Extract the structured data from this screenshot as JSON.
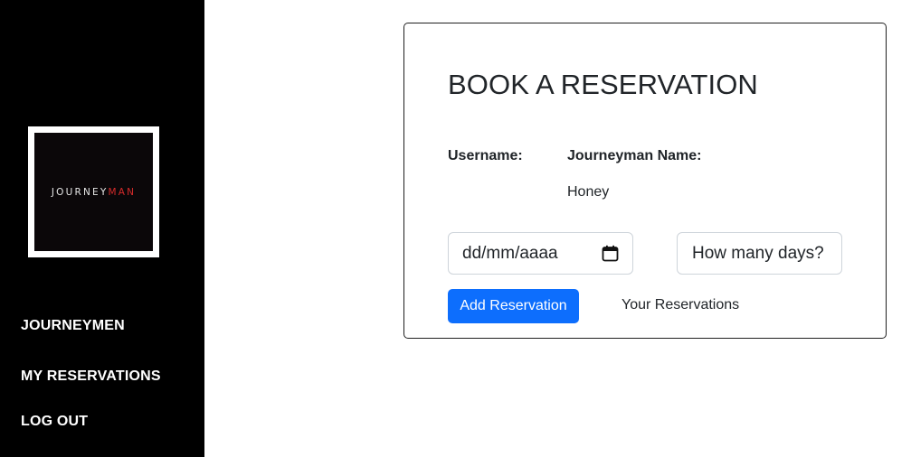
{
  "sidebar": {
    "logo": {
      "text_main": "JOURNEY",
      "text_accent": "MAN",
      "colors": {
        "background": "#0b0709",
        "text": "#e6e6e6",
        "accent": "#d42a2a"
      }
    },
    "nav": {
      "journeymen": "JOURNEYMEN",
      "my_reservations": "MY RESERVATIONS",
      "log_out": "LOG OUT"
    }
  },
  "booking": {
    "title": "BOOK A RESERVATION",
    "username_label": "Username:",
    "username_value": "",
    "journeyman_label": "Journeyman Name:",
    "journeyman_value": "Honey",
    "date_value": "dd/mm/aaaa",
    "date_icon": "calendar-icon",
    "days_placeholder": "How many days?",
    "add_button": "Add Reservation",
    "your_reservations_link": "Your Reservations"
  },
  "colors": {
    "sidebar_bg": "#000000",
    "primary_button": "#0d6efd",
    "text": "#212529",
    "input_border": "#ced4da"
  }
}
